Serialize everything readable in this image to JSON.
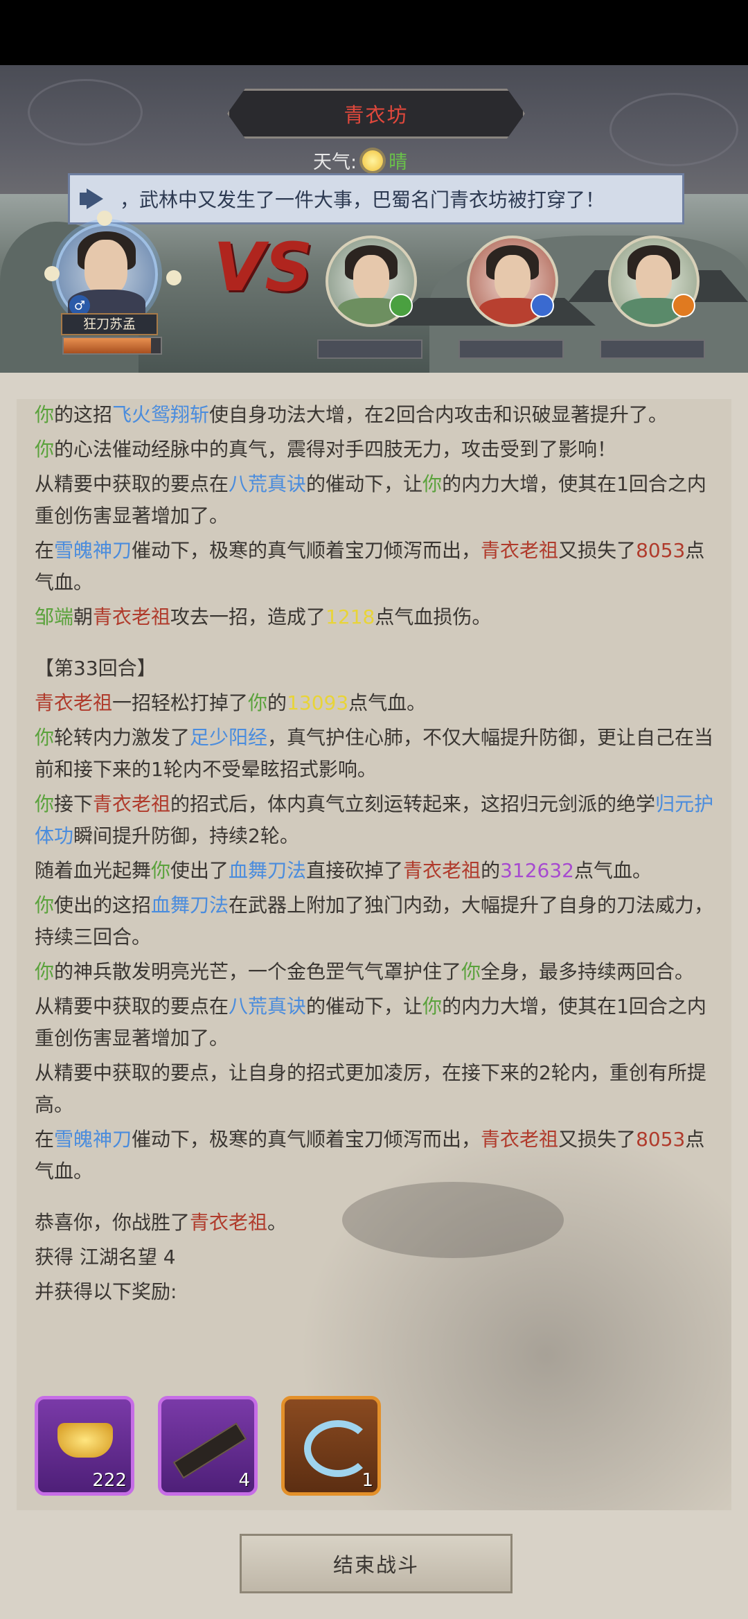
{
  "header": {
    "location_title": "青衣坊",
    "weather_label": "天气:",
    "weather_value": "晴",
    "weather_icon": "sun-icon"
  },
  "banner": {
    "icon": "megaphone-icon",
    "message": "，武林中又发生了一件大事，巴蜀名门青衣坊被打穿了！"
  },
  "battle": {
    "player_name": "狂刀苏孟",
    "player_hp_ratio": 0.9,
    "vs_label": "VS",
    "enemies": [
      {
        "badge": "green-badge"
      },
      {
        "badge": "blue-badge"
      },
      {
        "badge": "orange-badge"
      }
    ]
  },
  "log": [
    [
      {
        "t": "你",
        "c": "g"
      },
      {
        "t": "的这招"
      },
      {
        "t": "飞火鸳翔斩",
        "c": "b"
      },
      {
        "t": "使自身功法大增，在2回合内攻击和识破显著提升了。"
      }
    ],
    [
      {
        "t": "你",
        "c": "g"
      },
      {
        "t": "的心法催动经脉中的真气，震得对手四肢无力，攻击受到了影响！"
      }
    ],
    [
      {
        "t": "从精要中获取的要点在"
      },
      {
        "t": "八荒真诀",
        "c": "b"
      },
      {
        "t": "的催动下，让"
      },
      {
        "t": "你",
        "c": "g"
      },
      {
        "t": "的内力大增，使其在1回合之内重创伤害显著增加了。"
      }
    ],
    [
      {
        "t": "在"
      },
      {
        "t": "雪魄神刀",
        "c": "b"
      },
      {
        "t": "催动下，极寒的真气顺着宝刀倾泻而出，"
      },
      {
        "t": "青衣老祖",
        "c": "r"
      },
      {
        "t": "又损失了"
      },
      {
        "t": "8053",
        "c": "r"
      },
      {
        "t": "点气血。"
      }
    ],
    [
      {
        "t": "邹端",
        "c": "g"
      },
      {
        "t": "朝"
      },
      {
        "t": "青衣老祖",
        "c": "r"
      },
      {
        "t": "攻去一招，造成了"
      },
      {
        "t": "1218",
        "c": "y"
      },
      {
        "t": "点气血损伤。"
      }
    ],
    [
      {
        "t": "【第33回合】"
      }
    ],
    [
      {
        "t": "青衣老祖",
        "c": "r"
      },
      {
        "t": "一招轻松打掉了"
      },
      {
        "t": "你",
        "c": "g"
      },
      {
        "t": "的"
      },
      {
        "t": "13093",
        "c": "y"
      },
      {
        "t": "点气血。"
      }
    ],
    [
      {
        "t": "你",
        "c": "g"
      },
      {
        "t": "轮转内力激发了"
      },
      {
        "t": "足少阳经",
        "c": "b"
      },
      {
        "t": "，真气护住心肺，不仅大幅提升防御，更让自己在当前和接下来的1轮内不受晕眩招式影响。"
      }
    ],
    [
      {
        "t": "你",
        "c": "g"
      },
      {
        "t": "接下"
      },
      {
        "t": "青衣老祖",
        "c": "r"
      },
      {
        "t": "的招式后，体内真气立刻运转起来，这招归元剑派的绝学"
      },
      {
        "t": "归元护体功",
        "c": "b"
      },
      {
        "t": "瞬间提升防御，持续2轮。"
      }
    ],
    [
      {
        "t": "随着血光起舞"
      },
      {
        "t": "你",
        "c": "g"
      },
      {
        "t": "使出了"
      },
      {
        "t": "血舞刀法",
        "c": "b"
      },
      {
        "t": "直接砍掉了"
      },
      {
        "t": "青衣老祖",
        "c": "r"
      },
      {
        "t": "的"
      },
      {
        "t": "312632",
        "c": "p"
      },
      {
        "t": "点气血。"
      }
    ],
    [
      {
        "t": "你",
        "c": "g"
      },
      {
        "t": "使出的这招"
      },
      {
        "t": "血舞刀法",
        "c": "b"
      },
      {
        "t": "在武器上附加了独门内劲，大幅提升了自身的刀法威力，持续三回合。"
      }
    ],
    [
      {
        "t": "你",
        "c": "g"
      },
      {
        "t": "的神兵散发明亮光芒，一个金色罡气气罩护住了"
      },
      {
        "t": "你",
        "c": "g"
      },
      {
        "t": "全身，最多持续两回合。"
      }
    ],
    [
      {
        "t": "从精要中获取的要点在"
      },
      {
        "t": "八荒真诀",
        "c": "b"
      },
      {
        "t": "的催动下，让"
      },
      {
        "t": "你",
        "c": "g"
      },
      {
        "t": "的内力大增，使其在1回合之内重创伤害显著增加了。"
      }
    ],
    [
      {
        "t": "从精要中获取的要点，让自身的招式更加凌厉，在接下来的2轮内，重创有所提高。"
      }
    ],
    [
      {
        "t": "在"
      },
      {
        "t": "雪魄神刀",
        "c": "b"
      },
      {
        "t": "催动下，极寒的真气顺着宝刀倾泻而出，"
      },
      {
        "t": "青衣老祖",
        "c": "r"
      },
      {
        "t": "又损失了"
      },
      {
        "t": "8053",
        "c": "r"
      },
      {
        "t": "点气血。"
      }
    ],
    [
      {
        "t": "恭喜你，你战胜了"
      },
      {
        "t": "青衣老祖",
        "c": "r"
      },
      {
        "t": "。"
      }
    ],
    [
      {
        "t": "获得 "
      },
      {
        "t": "江湖名望 4"
      }
    ],
    [
      {
        "t": "并获得以下奖励:"
      }
    ]
  ],
  "gap_lines": [
    5,
    15
  ],
  "rewards": [
    {
      "name": "gold-ingot-icon",
      "count": "222",
      "rarity": "purple"
    },
    {
      "name": "secret-manual-icon",
      "count": "4",
      "rarity": "purple"
    },
    {
      "name": "blue-swirl-icon",
      "count": "1",
      "rarity": "orange"
    }
  ],
  "end_button": "结束战斗"
}
